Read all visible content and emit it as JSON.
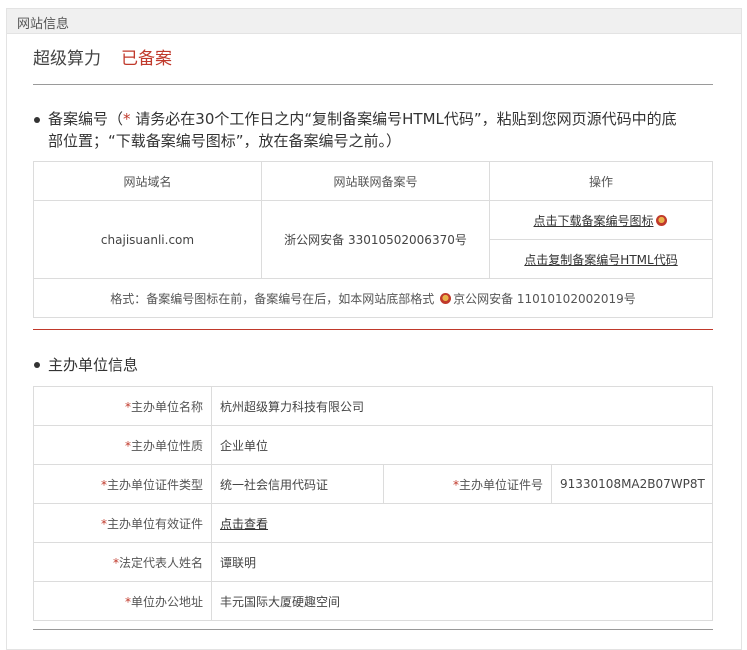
{
  "header": {
    "title": "网站信息"
  },
  "site": {
    "name": "超级算力",
    "status": "已备案"
  },
  "record_section": {
    "title": "备案编号（",
    "star": "*",
    "note_line1": " 请务必在30个工作日之内“复制备案编号HTML代码”，粘贴到您网页源代码中的底",
    "note_line2": "部位置；“下载备案编号图标”，放在备案编号之前。）",
    "columns": [
      "网站域名",
      "网站联网备案号",
      "操作"
    ],
    "domain": "chajisuanli.com",
    "record_no": "浙公网安备 33010502006370号",
    "download_link": "点击下载备案编号图标",
    "copy_link": "点击复制备案编号HTML代码",
    "format_prefix": "格式：备案编号图标在前，备案编号在后，如本网站底部格式",
    "format_example": "京公网安备 11010102002019号"
  },
  "org_section": {
    "title": "主办单位信息",
    "rows": [
      {
        "label": "主办单位名称",
        "value": "杭州超级算力科技有限公司"
      },
      {
        "label": "主办单位性质",
        "value": "企业单位"
      },
      {
        "label": "主办单位证件类型",
        "value": "统一社会信用代码证",
        "label2": "主办单位证件号",
        "value2": "91330108MA2B07WP8T"
      },
      {
        "label": "主办单位有效证件",
        "value": "点击查看"
      },
      {
        "label": "法定代表人姓名",
        "value": "谭联明"
      },
      {
        "label": "单位办公地址",
        "value": "丰元国际大厦硬趣空间"
      }
    ]
  }
}
